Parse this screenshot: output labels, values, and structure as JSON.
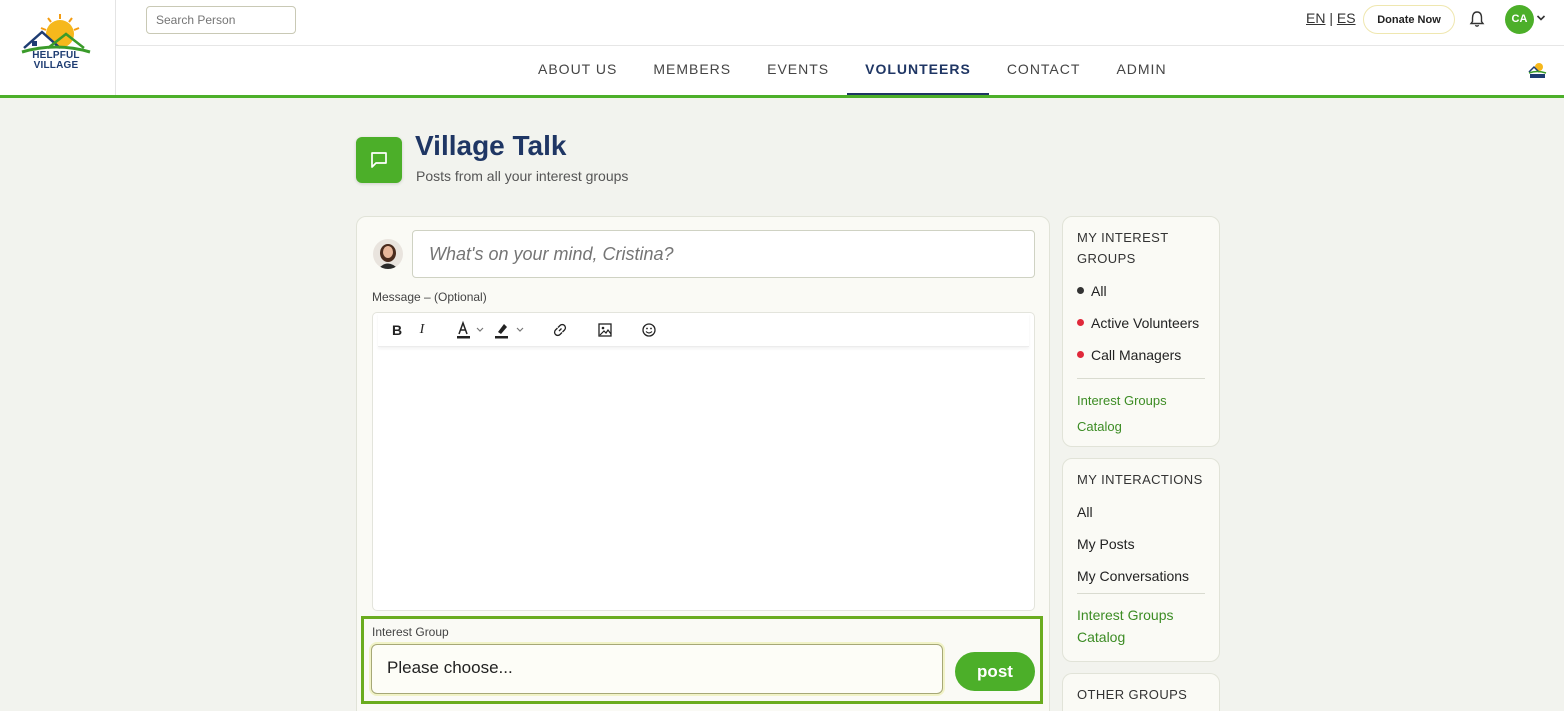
{
  "header": {
    "logo_text": [
      "HELPFUL",
      "VILLAGE"
    ],
    "search_placeholder": "Search Person",
    "lang_en": "EN",
    "lang_sep": "|",
    "lang_es": "ES",
    "donate_label": "Donate Now",
    "user_initials": "CA",
    "icons": [
      "bell-icon",
      "chevron-down-icon"
    ]
  },
  "nav": {
    "items": [
      "ABOUT US",
      "MEMBERS",
      "EVENTS",
      "VOLUNTEERS",
      "CONTACT",
      "ADMIN"
    ],
    "active": "VOLUNTEERS"
  },
  "page": {
    "title": "Village Talk",
    "subtitle": "Posts from all your interest groups"
  },
  "composer": {
    "placeholder": "What's on your mind, Cristina?",
    "message_label": "Message – (Optional)",
    "toolbar": {
      "bold": "B",
      "italic": "I",
      "text_color": "A",
      "icons": [
        "bold-icon",
        "italic-icon",
        "text-color-icon",
        "highlight-icon",
        "link-icon",
        "image-icon",
        "emoji-icon"
      ]
    },
    "interest_group_label": "Interest Group",
    "interest_group_value": "Please choose...",
    "post_label": "post"
  },
  "sidebar": {
    "interest_groups": {
      "heading": "MY INTEREST GROUPS",
      "items": [
        {
          "label": "All",
          "dot": "#333333"
        },
        {
          "label": "Active Volunteers",
          "dot": "#e0283a"
        },
        {
          "label": "Call Managers",
          "dot": "#e0283a"
        }
      ],
      "catalog_link": [
        "Interest Groups",
        "Catalog"
      ]
    },
    "interactions": {
      "heading": "MY INTERACTIONS",
      "items": [
        "All",
        "My Posts",
        "My Conversations"
      ],
      "catalog_link": [
        "Interest Groups",
        "Catalog"
      ]
    },
    "other_groups": {
      "heading": "OTHER GROUPS"
    }
  },
  "colors": {
    "brand_green": "#4caf29",
    "navy": "#1f3664",
    "highlight_frame": "#6aac1f"
  }
}
